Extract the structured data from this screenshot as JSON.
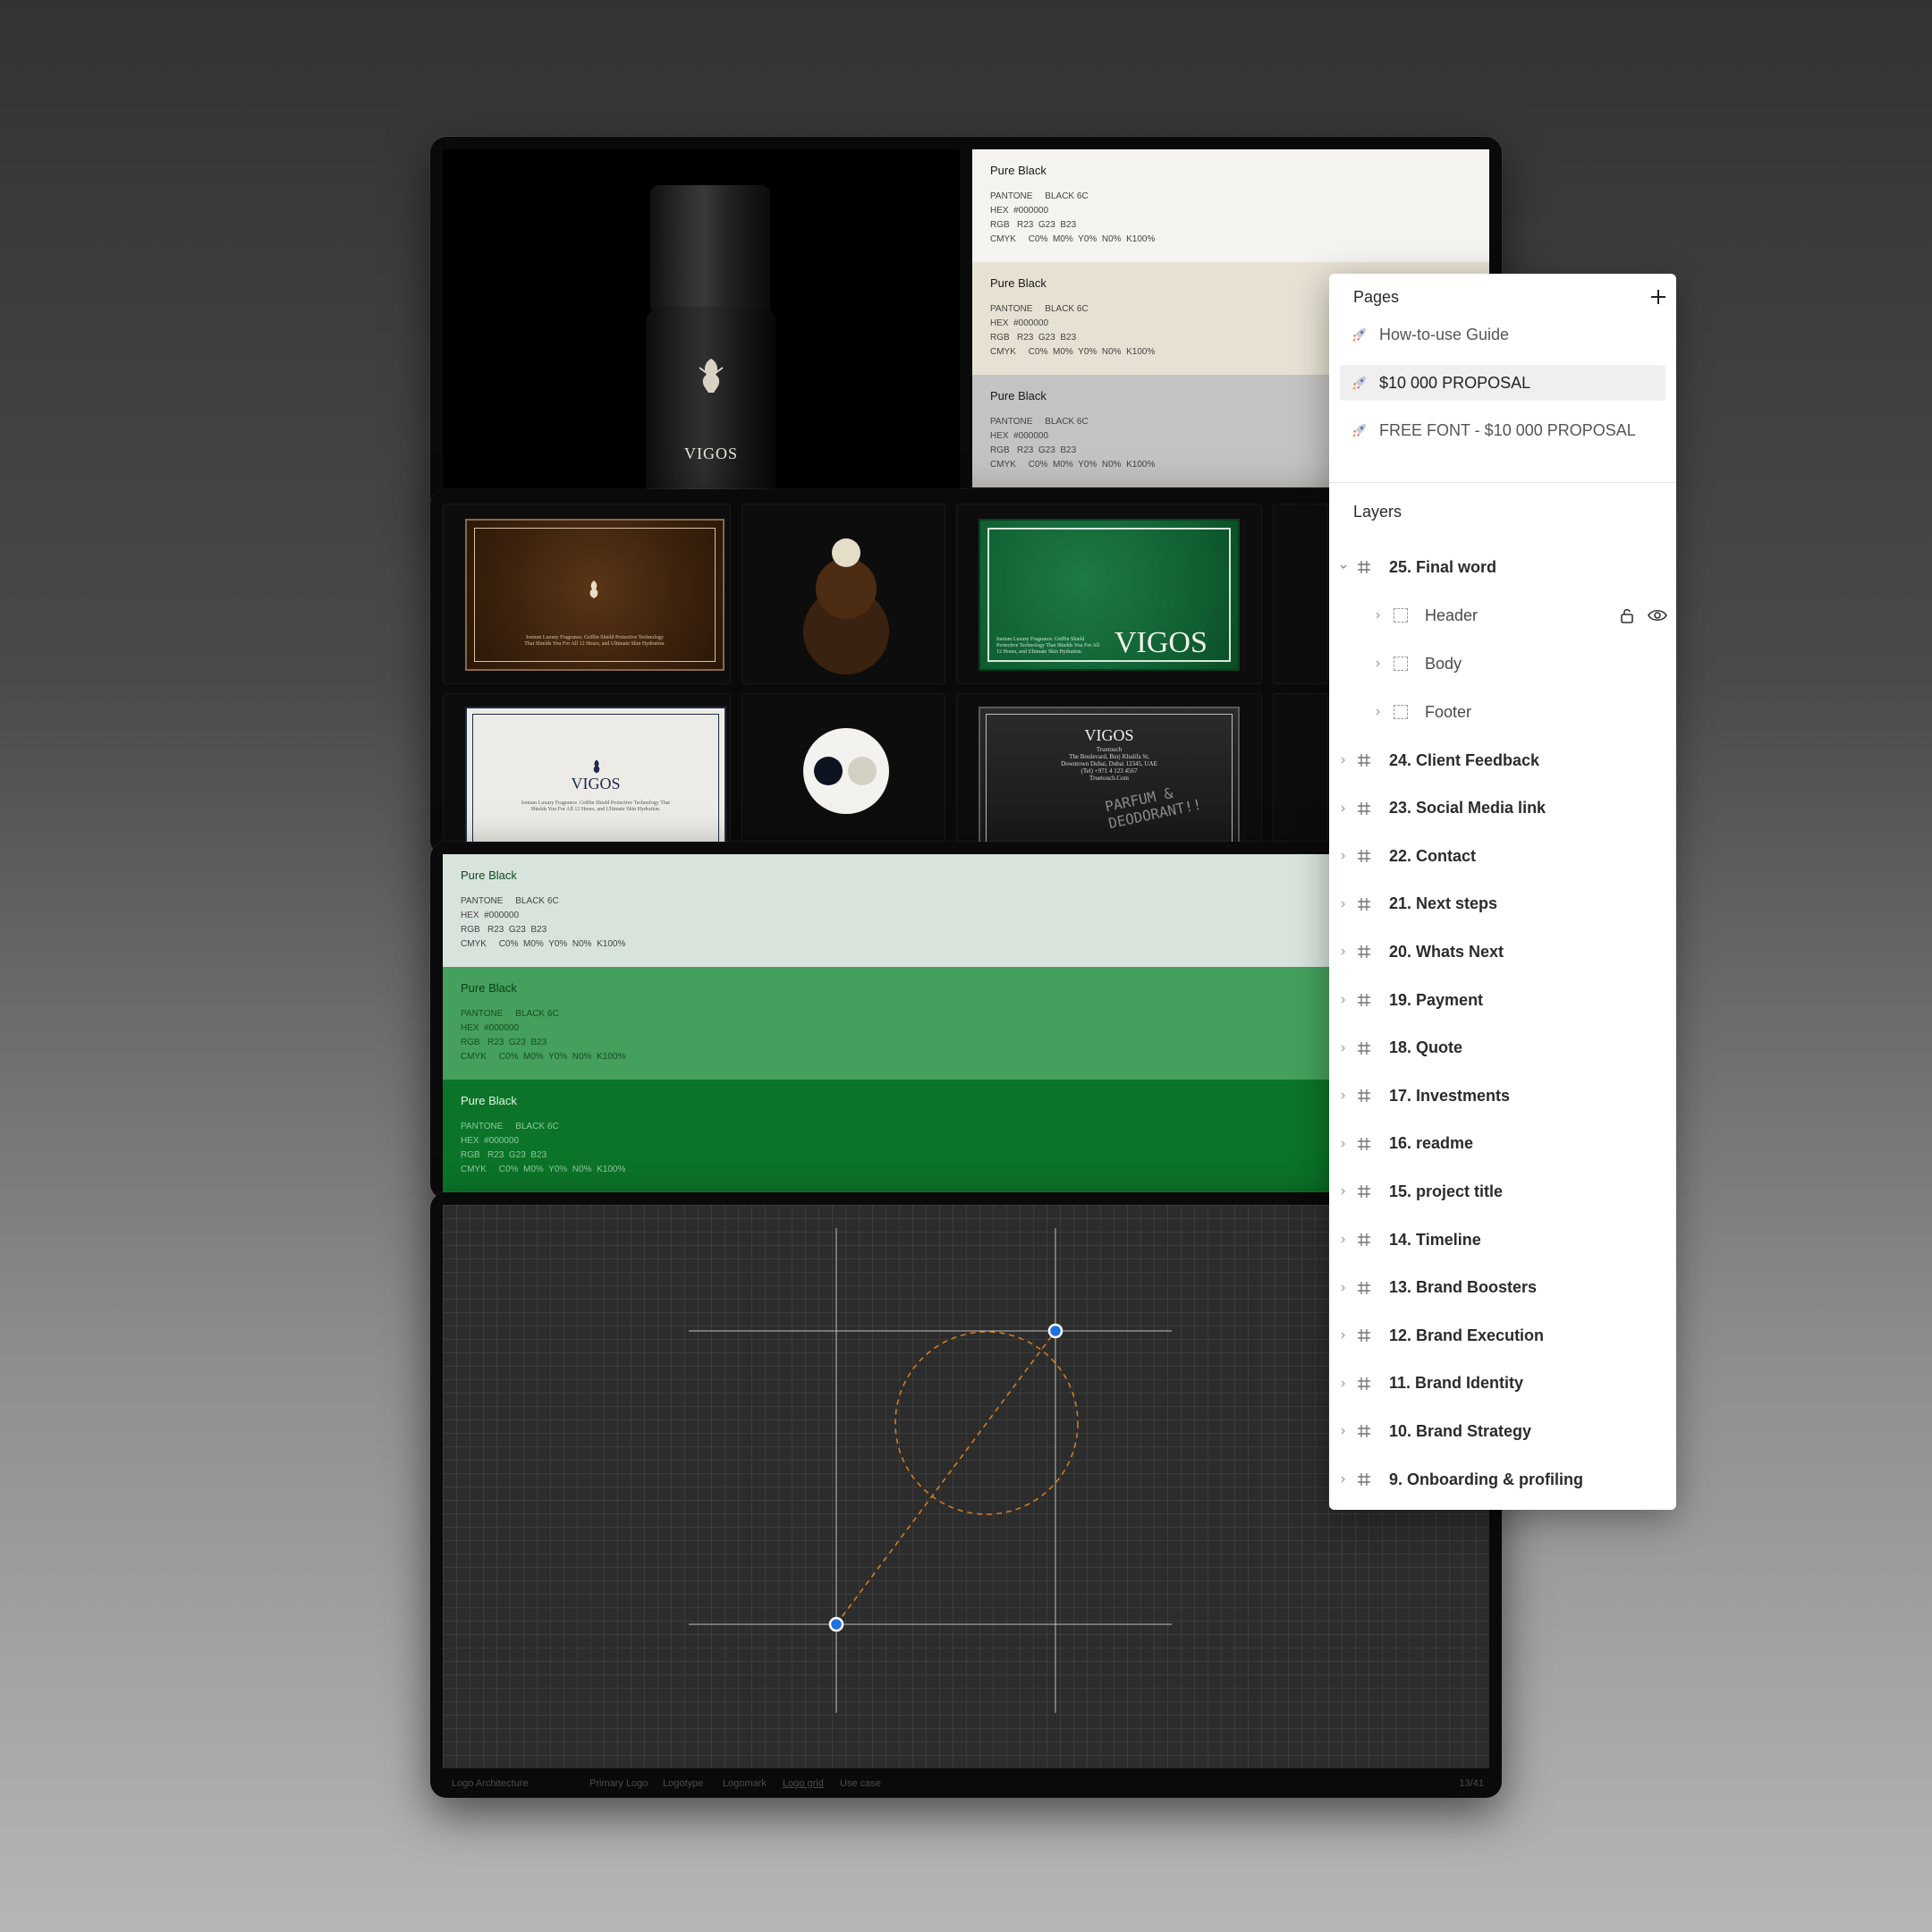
{
  "swatch_top": [
    {
      "title": "Pure Black",
      "pantone": "PANTONE     BLACK 6C",
      "hex": "HEX  #000000",
      "rgb": "RGB   R23  G23  B23",
      "cmyk": "CMYK     C0%  M0%  Y0%  N0%  K100%",
      "bg": "#f4f3ef"
    },
    {
      "title": "Pure Black",
      "pantone": "PANTONE     BLACK 6C",
      "hex": "HEX  #000000",
      "rgb": "RGB   R23  G23  B23",
      "cmyk": "CMYK     C0%  M0%  Y0%  N0%  K100%",
      "bg": "#e6e1d3"
    },
    {
      "title": "Pure Black",
      "pantone": "PANTONE     BLACK 6C",
      "hex": "HEX  #000000",
      "rgb": "RGB   R23  G23  B23",
      "cmyk": "CMYK     C0%  M0%  Y0%  N0%  K100%",
      "bg": "#c4c3c1"
    }
  ],
  "swatch_green": [
    {
      "title": "Pure Black",
      "pantone": "PANTONE     BLACK 6C",
      "hex": "HEX  #000000",
      "rgb": "RGB   R23  G23  B23",
      "cmyk": "CMYK     C0%  M0%  Y0%  N0%  K100%",
      "bg": "#d8e3dc"
    },
    {
      "title": "Pure Black",
      "pantone": "PANTONE     BLACK 6C",
      "hex": "HEX  #000000",
      "rgb": "RGB   R23  G23  B23",
      "cmyk": "CMYK     C0%  M0%  Y0%  N0%  K100%",
      "bg": "#44a05c"
    },
    {
      "title": "Pure Black",
      "pantone": "PANTONE     BLACK 6C",
      "hex": "HEX  #000000",
      "rgb": "RGB   R23  G23  B23",
      "cmyk": "CMYK     C0%  M0%  Y0%  N0%  K100%",
      "bg": "#0b7428"
    }
  ],
  "brand": {
    "bottle_logo": "VIGOS",
    "green_card_logo": "VIGOS",
    "cream_card_logo": "VIGOS",
    "dark_card_logo": "VIGOS",
    "card_tagline": "Ionium Luxury Fragrance. Griffin Shield Protective Technology That Shields You For All 12 Hours, and Ultimate Skin Hydration.",
    "dark_card_address": [
      "Truetouch",
      "The Boulevard, Burj Khalifa St,",
      "Downtown Dubai, Dubai 12345, UAE",
      "(Tel) +971 4 123 4567",
      "Truetouch.Com"
    ],
    "dark_card_scribble": "PARFUM & DEODORANT!!"
  },
  "footer": {
    "left": "Logo Architecture",
    "tabs": [
      "Primary Logo",
      "Logotype",
      "Logomark",
      "Logo grid",
      "Use case"
    ],
    "page_count": "13/41"
  },
  "panel": {
    "pages_title": "Pages",
    "pages": [
      {
        "label": "How-to-use Guide",
        "active": false
      },
      {
        "label": "$10 000 PROPOSAL",
        "active": true
      },
      {
        "label": "FREE FONT - $10 000 PROPOSAL",
        "active": false
      }
    ],
    "layers_title": "Layers",
    "expanded_layer": "25. Final word",
    "sub_layers": [
      "Header",
      "Body",
      "Footer"
    ],
    "layers": [
      "24. Client Feedback",
      "23. Social Media link",
      "22. Contact",
      "21. Next steps",
      "20. Whats Next",
      "19. Payment",
      "18. Quote",
      "17. Investments",
      "16. readme",
      "15. project title",
      "14. Timeline",
      "13. Brand Boosters",
      "12. Brand Execution",
      "11. Brand Identity",
      "10. Brand Strategy",
      "9. Onboarding & profiling"
    ]
  },
  "colors": {
    "accent_blue": "#1f6fe0",
    "guide_orange": "#d9801f"
  }
}
